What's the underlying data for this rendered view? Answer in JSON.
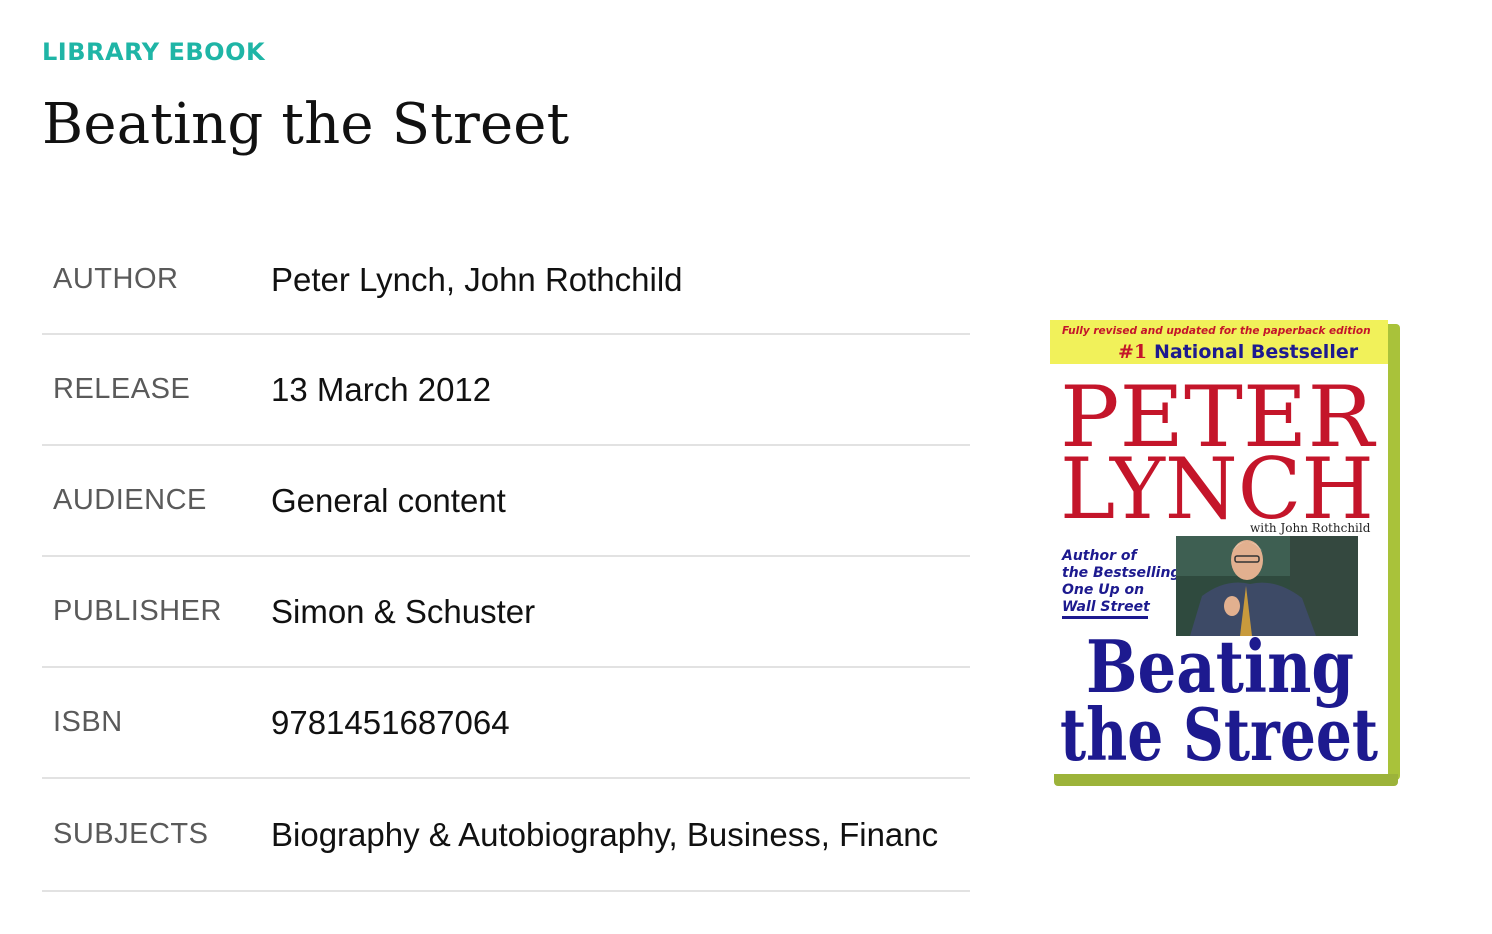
{
  "page": {
    "eyebrow": "LIBRARY EBOOK",
    "title": "Beating the Street"
  },
  "details": [
    {
      "key": "AUTHOR",
      "value": "Peter Lynch, John Rothchild"
    },
    {
      "key": "RELEASE",
      "value": "13 March 2012"
    },
    {
      "key": "AUDIENCE",
      "value": "General content"
    },
    {
      "key": "PUBLISHER",
      "value": "Simon & Schuster"
    },
    {
      "key": "ISBN",
      "value": "9781451687064"
    },
    {
      "key": "SUBJECTS",
      "value": "Biography & Autobiography, Business, Financ"
    }
  ],
  "cover": {
    "tagline": "Fully revised and updated for the paperback edition",
    "bestseller_num": "#1",
    "bestseller": "National Bestseller",
    "author_line1": "PETER",
    "author_line2": "LYNCH",
    "coauthor": "with John Rothchild",
    "blurb1": "Author of",
    "blurb2": "the Bestselling",
    "blurb3": "One Up on",
    "blurb4": "Wall Street",
    "title1": "Beating",
    "title2": "the Street"
  },
  "colors": {
    "accent": "#1fb5a6",
    "cover_red": "#c4152a",
    "cover_blue": "#1d1a8f",
    "cover_yellow": "#f1f15a",
    "cover_green": "#a9c23a"
  }
}
